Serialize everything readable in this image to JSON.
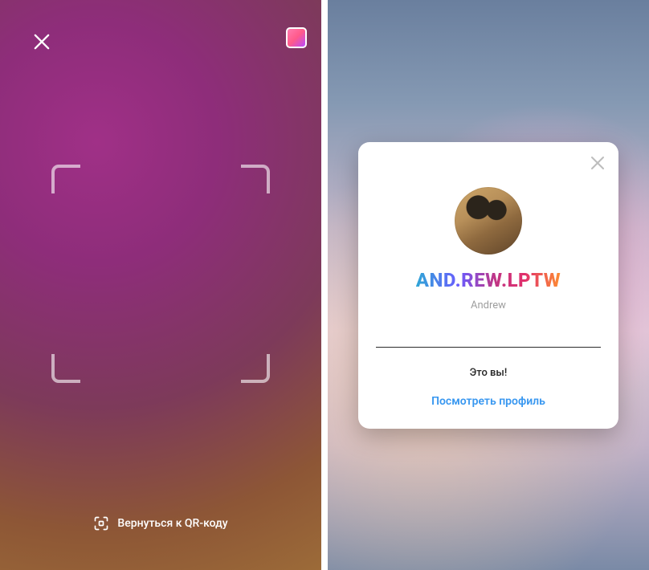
{
  "left": {
    "close_icon": "close-icon",
    "gallery_icon": "gallery-thumb-icon",
    "return_label": "Вернуться к QR-коду"
  },
  "card": {
    "username": "AND.REW.LPTW",
    "displayname": "Andrew",
    "thats_you": "Это вы!",
    "view_profile": "Посмотреть профиль"
  }
}
